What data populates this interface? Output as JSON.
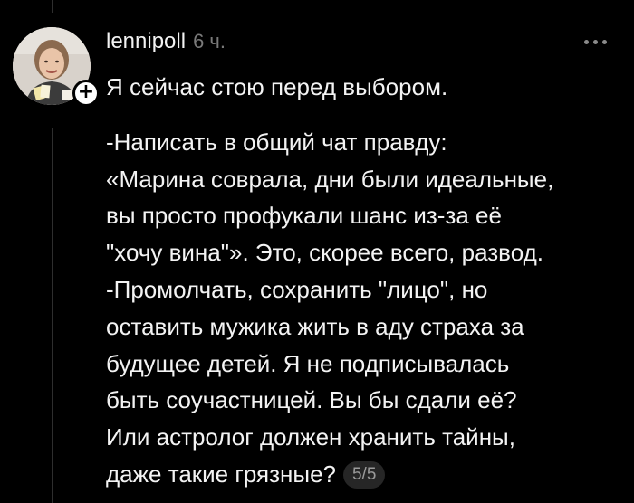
{
  "post": {
    "username": "lennipoll",
    "timestamp": "6 ч.",
    "lines": [
      "Я сейчас стою перед выбором.",
      "",
      "-Написать в общий чат правду:",
      "«Марина соврала, дни были идеальные,",
      "вы просто профукали шанс из-за её",
      "\"хочу вина\"». Это, скорее всего, развод.",
      "-Промолчать, сохранить \"лицо\", но",
      "оставить мужика жить в аду страха за",
      "будущее детей. Я не подписывалась",
      "быть соучастницей. Вы бы сдали её?",
      "Или астролог должен хранить тайны,",
      "даже такие грязные?"
    ],
    "page_indicator": "5/5"
  },
  "icons": {
    "more": "more-horizontal-icon",
    "follow": "plus-icon"
  },
  "colors": {
    "background": "#000000",
    "text": "#f3f3f3",
    "muted": "#7a7a7a",
    "pill": "#262626"
  }
}
